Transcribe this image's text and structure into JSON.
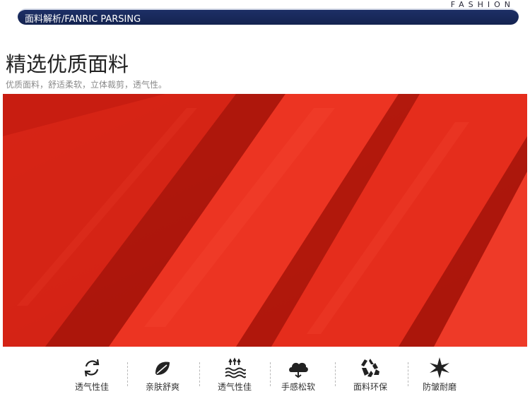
{
  "header": {
    "fashion": "FASHION",
    "banner_title": "面料解析/FANRIC PARSING"
  },
  "section": {
    "title": "精选优质面料",
    "subtitle": "优质面料，舒适柔软，立体裁剪，透气性。"
  },
  "colors": {
    "banner": "#1b2b5f",
    "fabric_red": "#e0281a",
    "icon": "#222222"
  },
  "features": [
    {
      "label": "透气性佳",
      "icon": "recycle-arrows-icon"
    },
    {
      "label": "亲肤舒爽",
      "icon": "leaf-icon"
    },
    {
      "label": "透气性佳",
      "icon": "waves-icon"
    },
    {
      "label": "手感松软",
      "icon": "cloud-icon"
    },
    {
      "label": "面料环保",
      "icon": "recycle-icon"
    },
    {
      "label": "防皱耐磨",
      "icon": "star-icon"
    }
  ]
}
